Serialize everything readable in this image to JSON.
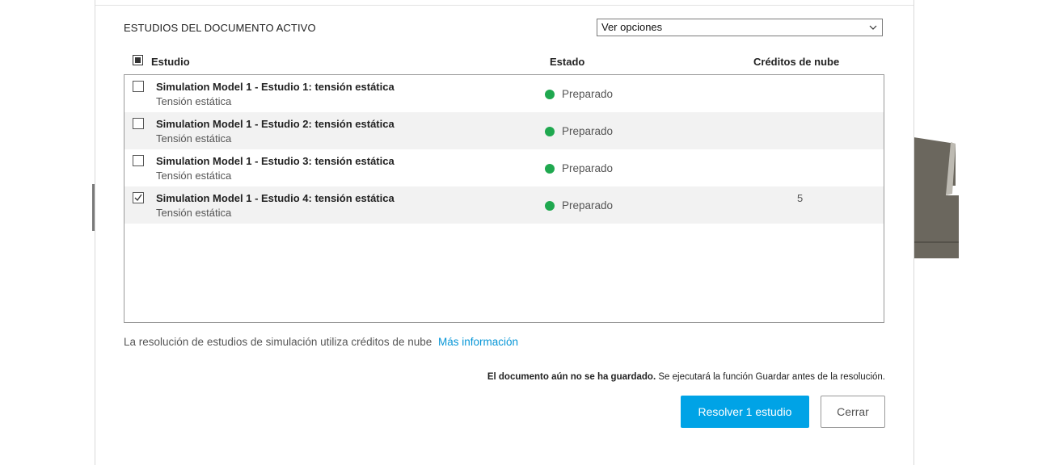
{
  "dialog": {
    "section_title": "ESTUDIOS DEL DOCUMENTO ACTIVO",
    "options_select": "Ver opciones",
    "columns": {
      "study": "Estudio",
      "status": "Estado",
      "credits": "Créditos de nube"
    },
    "studies": [
      {
        "name": "Simulation Model 1 - Estudio 1: tensión estática",
        "type": "Tensión estática",
        "status": "Preparado",
        "checked": false,
        "credits": ""
      },
      {
        "name": "Simulation Model 1 - Estudio 2: tensión estática",
        "type": "Tensión estática",
        "status": "Preparado",
        "checked": false,
        "credits": ""
      },
      {
        "name": "Simulation Model 1 - Estudio 3: tensión estática",
        "type": "Tensión estática",
        "status": "Preparado",
        "checked": false,
        "credits": ""
      },
      {
        "name": "Simulation Model 1 - Estudio 4: tensión estática",
        "type": "Tensión estática",
        "status": "Preparado",
        "checked": true,
        "credits": "5"
      }
    ],
    "info_text": "La resolución de estudios de simulación utiliza créditos de nube",
    "info_link": "Más información",
    "save_warning_bold": "El documento aún no se ha guardado.",
    "save_warning_rest": " Se ejecutará la función Guardar antes de la resolución.",
    "solve_button": "Resolver 1 estudio",
    "close_button": "Cerrar",
    "colors": {
      "accent": "#00a3e6",
      "link": "#0696d7",
      "status_ready": "#1fa84f"
    }
  }
}
